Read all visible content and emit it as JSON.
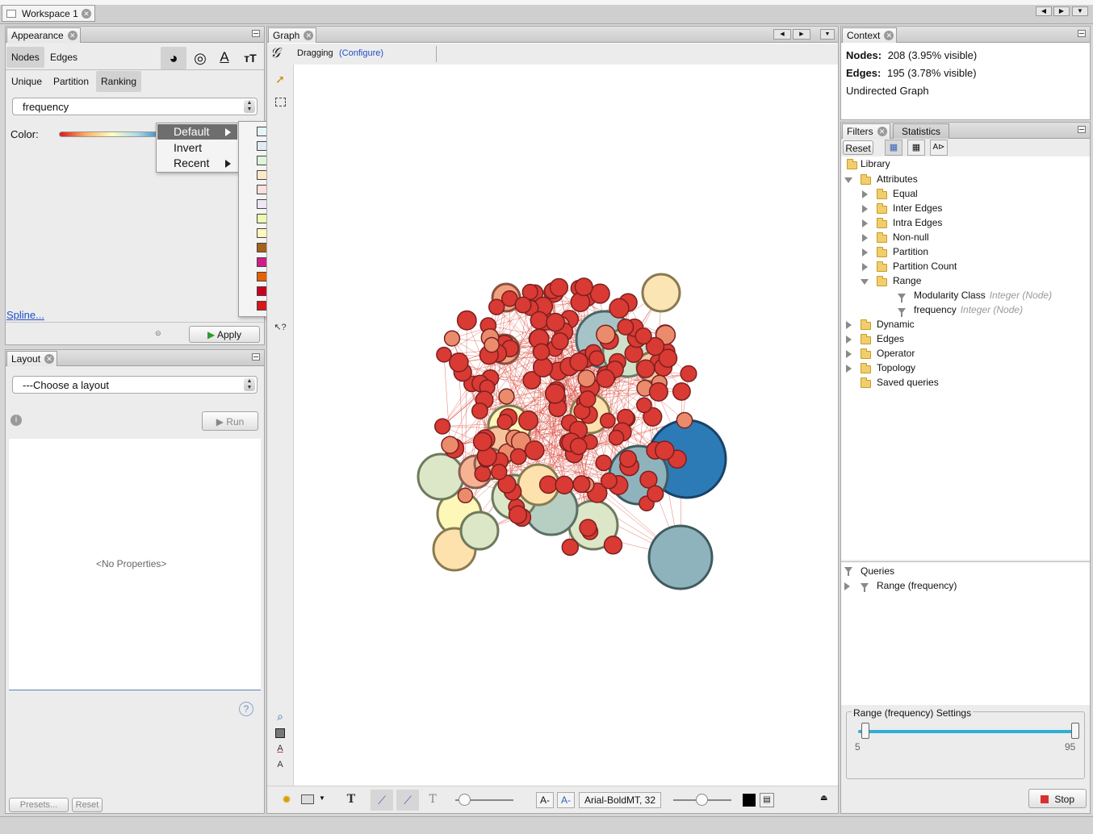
{
  "workspace": {
    "tab_label": "Workspace 1"
  },
  "appearance": {
    "title": "Appearance",
    "element_tabs": [
      "Nodes",
      "Edges"
    ],
    "mode_tabs": [
      "Unique",
      "Partition",
      "Ranking"
    ],
    "attribute_select": "frequency",
    "color_label": "Color:",
    "spline_link": "Spline...",
    "apply_button": "Apply",
    "palette_menu": {
      "items": [
        {
          "label": "Default",
          "has_submenu": true
        },
        {
          "label": "Invert",
          "has_submenu": false
        },
        {
          "label": "Recent",
          "has_submenu": true
        }
      ],
      "palettes": [
        [
          "#e5f5f9",
          "#99d8c9",
          "#2ca25f"
        ],
        [
          "#e0ecf4",
          "#9ebcda",
          "#8856a7"
        ],
        [
          "#e0f3db",
          "#a8ddb5",
          "#43a2ca"
        ],
        [
          "#fee8c8",
          "#fdbb84",
          "#e34a33"
        ],
        [
          "#fde0dd",
          "#fa9fb5",
          "#c51b8a"
        ],
        [
          "#ece7f2",
          "#a6bddb",
          "#2b8cbe"
        ],
        [
          "#edf8b1",
          "#7fcdbb",
          "#2c7fb8"
        ],
        [
          "#fff7bc",
          "#fec44f",
          "#d95f0e"
        ],
        [
          "#a6611a",
          "#f5f5f5",
          "#018571"
        ],
        [
          "#d01c8b",
          "#f7f7f7",
          "#4dac26"
        ],
        [
          "#e66101",
          "#f7f7f7",
          "#5e3c99"
        ],
        [
          "#ca0020",
          "#f7f7f7",
          "#404040"
        ],
        [
          "#d7191c",
          "#ffffbf",
          "#2c7bb6"
        ]
      ]
    }
  },
  "layout": {
    "title": "Layout",
    "select": "---Choose a layout",
    "run_button": "Run",
    "no_properties": "<No Properties>",
    "presets_button": "Presets...",
    "reset_button": "Reset"
  },
  "graph": {
    "title": "Graph",
    "tool_status": "Dragging",
    "configure_link": "(Configure)",
    "font_label": "Arial-BoldMT, 32"
  },
  "context": {
    "title": "Context",
    "nodes_label": "Nodes:",
    "nodes_value": "208 (3.95% visible)",
    "edges_label": "Edges:",
    "edges_value": "195 (3.78% visible)",
    "graph_type": "Undirected Graph"
  },
  "filters": {
    "tabs": [
      "Filters",
      "Statistics"
    ],
    "reset_button": "Reset",
    "library_label": "Library",
    "tree": [
      {
        "label": "Attributes",
        "level": 1,
        "expanded": true
      },
      {
        "label": "Equal",
        "level": 2,
        "expanded": false
      },
      {
        "label": "Inter Edges",
        "level": 2,
        "expanded": false
      },
      {
        "label": "Intra Edges",
        "level": 2,
        "expanded": false
      },
      {
        "label": "Non-null",
        "level": 2,
        "expanded": false
      },
      {
        "label": "Partition",
        "level": 2,
        "expanded": false
      },
      {
        "label": "Partition Count",
        "level": 2,
        "expanded": false
      },
      {
        "label": "Range",
        "level": 2,
        "expanded": true
      },
      {
        "label": "Modularity Class",
        "level": 3,
        "type": "Integer (Node)"
      },
      {
        "label": "frequency",
        "level": 3,
        "type": "Integer (Node)"
      },
      {
        "label": "Dynamic",
        "level": 1,
        "expanded": false
      },
      {
        "label": "Edges",
        "level": 1,
        "expanded": false
      },
      {
        "label": "Operator",
        "level": 1,
        "expanded": false
      },
      {
        "label": "Topology",
        "level": 1,
        "expanded": false
      },
      {
        "label": "Saved queries",
        "level": 1,
        "expanded": null
      }
    ],
    "queries_label": "Queries",
    "query_item": "Range (frequency)",
    "settings_title": "Range (frequency) Settings",
    "range_min": "5",
    "range_max": "95",
    "stop_button": "Stop"
  },
  "colors": {
    "edge": "#d94a3b",
    "node_red": "#d93a33",
    "node_blue": "#2c7bb6",
    "accent_link": "#1f4fc8"
  }
}
